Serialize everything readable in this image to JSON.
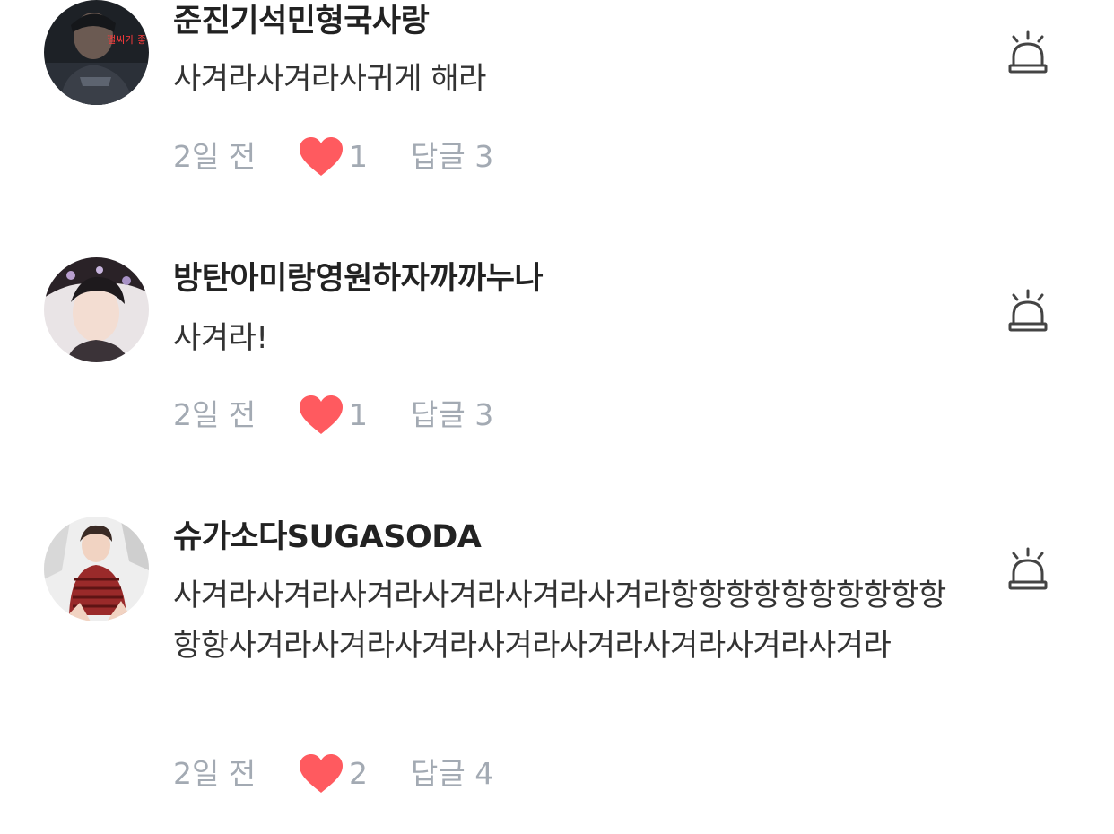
{
  "comments": [
    {
      "username": "준진기석민형국사랑",
      "text": "사겨라사겨라사귀게 해라",
      "time": "2일 전",
      "likes": "1",
      "reply": "답글 3",
      "avatar_overlay_text": "쩔씨가 좋구나"
    },
    {
      "username": "방탄아미랑영원하자까까누나",
      "text": "사겨라!",
      "time": "2일 전",
      "likes": "1",
      "reply": "답글 3"
    },
    {
      "username": "슈가소다SUGASODA",
      "text": "사겨라사겨라사겨라사겨라사겨라사겨라항항항항항항항항항항항항사겨라사겨라사겨라사겨라사겨라사겨라사겨라사겨라",
      "time": "2일 전",
      "likes": "2",
      "reply": "답글 4"
    }
  ],
  "icons": {
    "like": "heart-icon",
    "report": "siren-alarm-icon"
  },
  "colors": {
    "heart": "#ff5a5f",
    "meta_text": "#a3aab3",
    "username": "#222222",
    "body_text": "#333333"
  }
}
